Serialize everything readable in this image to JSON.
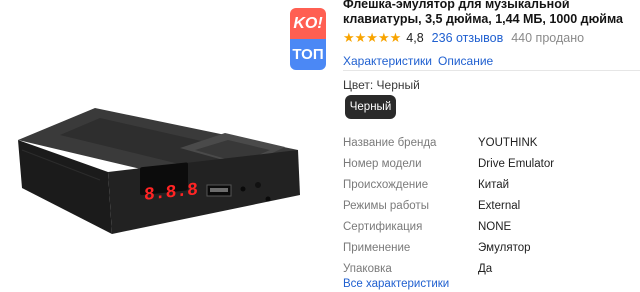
{
  "badge": {
    "top": "KO!",
    "bottom": "ТОП"
  },
  "product": {
    "title": "Флешка-эмулятор для музыкальной клавиатуры, 3,5 дюйма, 1,44 МБ, 1000 дюйма",
    "stars": "★★★★★",
    "rating": "4,8",
    "reviews": "236 отзывов",
    "sold": "440 продано",
    "display_digits": "8.8.8"
  },
  "links": [
    "Характеристики",
    "Описание"
  ],
  "color": {
    "label": "Цвет: Черный",
    "selected": "Черный"
  },
  "specs": [
    {
      "key": "Название бренда",
      "value": "YOUTHINK"
    },
    {
      "key": "Номер модели",
      "value": "Drive Emulator"
    },
    {
      "key": "Происхождение",
      "value": "Китай"
    },
    {
      "key": "Режимы работы",
      "value": "External"
    },
    {
      "key": "Сертификация",
      "value": "NONE"
    },
    {
      "key": "Применение",
      "value": "Эмулятор"
    },
    {
      "key": "Упаковка",
      "value": "Да"
    }
  ],
  "more_link": "Все характеристики",
  "colors": {
    "star": "#f8a400",
    "link": "#2060d0",
    "badge_top": "#ff5f52",
    "badge_bottom": "#4b88f5"
  }
}
